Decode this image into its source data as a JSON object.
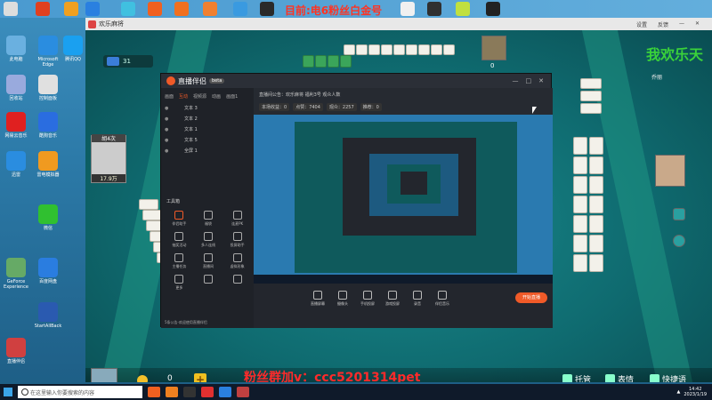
{
  "top": {
    "title": "目前:电6粉丝白金号"
  },
  "desktop": {
    "icons": [
      {
        "label": "此电脑",
        "color": "#6ab0e0"
      },
      {
        "label": "Microsoft Edge",
        "color": "#2a8de0"
      },
      {
        "label": "腾讯QQ",
        "color": "#1aa0f0"
      },
      {
        "label": "回收站",
        "color": "#9ad"
      },
      {
        "label": "控制面板",
        "color": "#e0e0e0"
      },
      {
        "label": "网易云音乐",
        "color": "#e02020"
      },
      {
        "label": "酷狗音乐",
        "color": "#2a6de0"
      },
      {
        "label": "迅雷",
        "color": "#2a8de0"
      },
      {
        "label": "雷电模拟器",
        "color": "#f09a20"
      },
      {
        "label": "微信",
        "color": "#30c030"
      },
      {
        "label": "GeForce Experience",
        "color": "#6a6"
      },
      {
        "label": "百度网盘",
        "color": "#2a7de0"
      },
      {
        "label": "StartAllBack",
        "color": "#2a5ab0"
      },
      {
        "label": "直播伴侣",
        "color": "#d04040"
      }
    ]
  },
  "game": {
    "window_title": "欢乐麻将",
    "menu": [
      "设置",
      "反馈"
    ],
    "hud_count": "31",
    "player_left": {
      "badge": "胡4次",
      "score": "17.9万"
    },
    "top_score": "0",
    "right_name": "我欢乐天",
    "right_user": "乔丽",
    "coin_value": "0",
    "plus_label": "+",
    "overlay_text": "粉丝群加v：ccc5201314pet",
    "buttons": [
      "托管",
      "表情",
      "快捷语"
    ]
  },
  "stream": {
    "app_name": "直播伴侣",
    "version": "beta",
    "tabs": [
      "画面",
      "互动",
      "视频源",
      "动画",
      "画面1"
    ],
    "sources": [
      "文本 3",
      "文本 2",
      "文本 1",
      "文本 5",
      "全屏 1"
    ],
    "tools_header": "工具箱",
    "tools": [
      "伴侣助手",
      "福袋",
      "连麦PK",
      "抽奖活动",
      "多人连线",
      "投屏助手",
      "主播任务",
      "直播间",
      "虚拟形象",
      "更多",
      "",
      ""
    ],
    "footer": "5条公告·欢迎使用直播伴侣",
    "toprow_text": "直播间公告：欢乐麻将 福利3号 观众人数",
    "toprow_stats": [
      "本场收益：0",
      "点赞：7404",
      "观众：2257",
      "推荐：0"
    ],
    "bottom_buttons": [
      "直播屏幕",
      "摄像头",
      "手机投屏",
      "游戏投屏",
      "录音",
      "伴侣音乐"
    ],
    "golive": "开始直播"
  },
  "taskbar": {
    "search_placeholder": "在这里输入你要搜索的内容",
    "time": "14:42",
    "date": "2023/1/19"
  }
}
